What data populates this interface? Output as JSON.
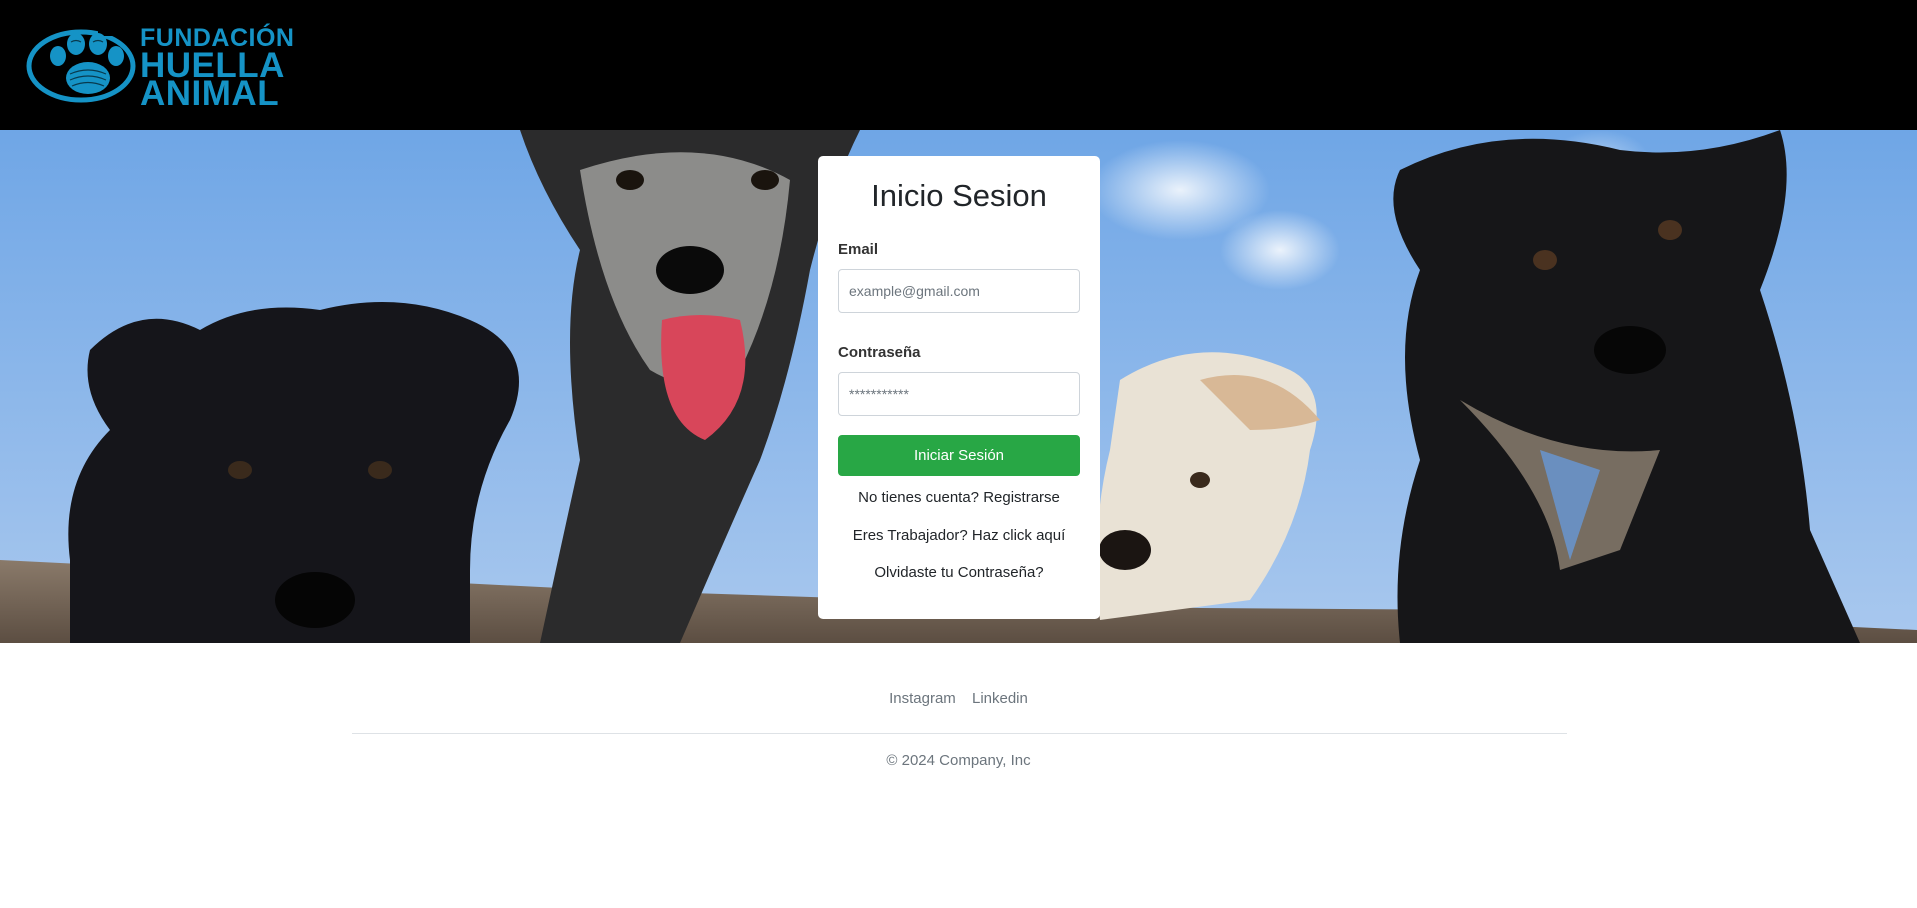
{
  "brand": {
    "line1": "FUNDACIÓN",
    "line2": "HUELLA",
    "line3": "ANIMAL",
    "color": "#1593c6",
    "icon": "paw-print-logo"
  },
  "login": {
    "title": "Inicio Sesion",
    "email_label": "Email",
    "email_placeholder": "example@gmail.com",
    "password_label": "Contraseña",
    "password_placeholder": "***********",
    "submit_label": "Iniciar Sesión",
    "register_link": "No tienes cuenta? Registrarse",
    "worker_link": "Eres Trabajador? Haz click aquí",
    "forgot_link": "Olvidaste tu Contraseña?",
    "submit_color": "#28a745"
  },
  "footer": {
    "links": [
      "Instagram",
      "Linkedin"
    ],
    "copyright": "© 2024 Company, Inc"
  }
}
